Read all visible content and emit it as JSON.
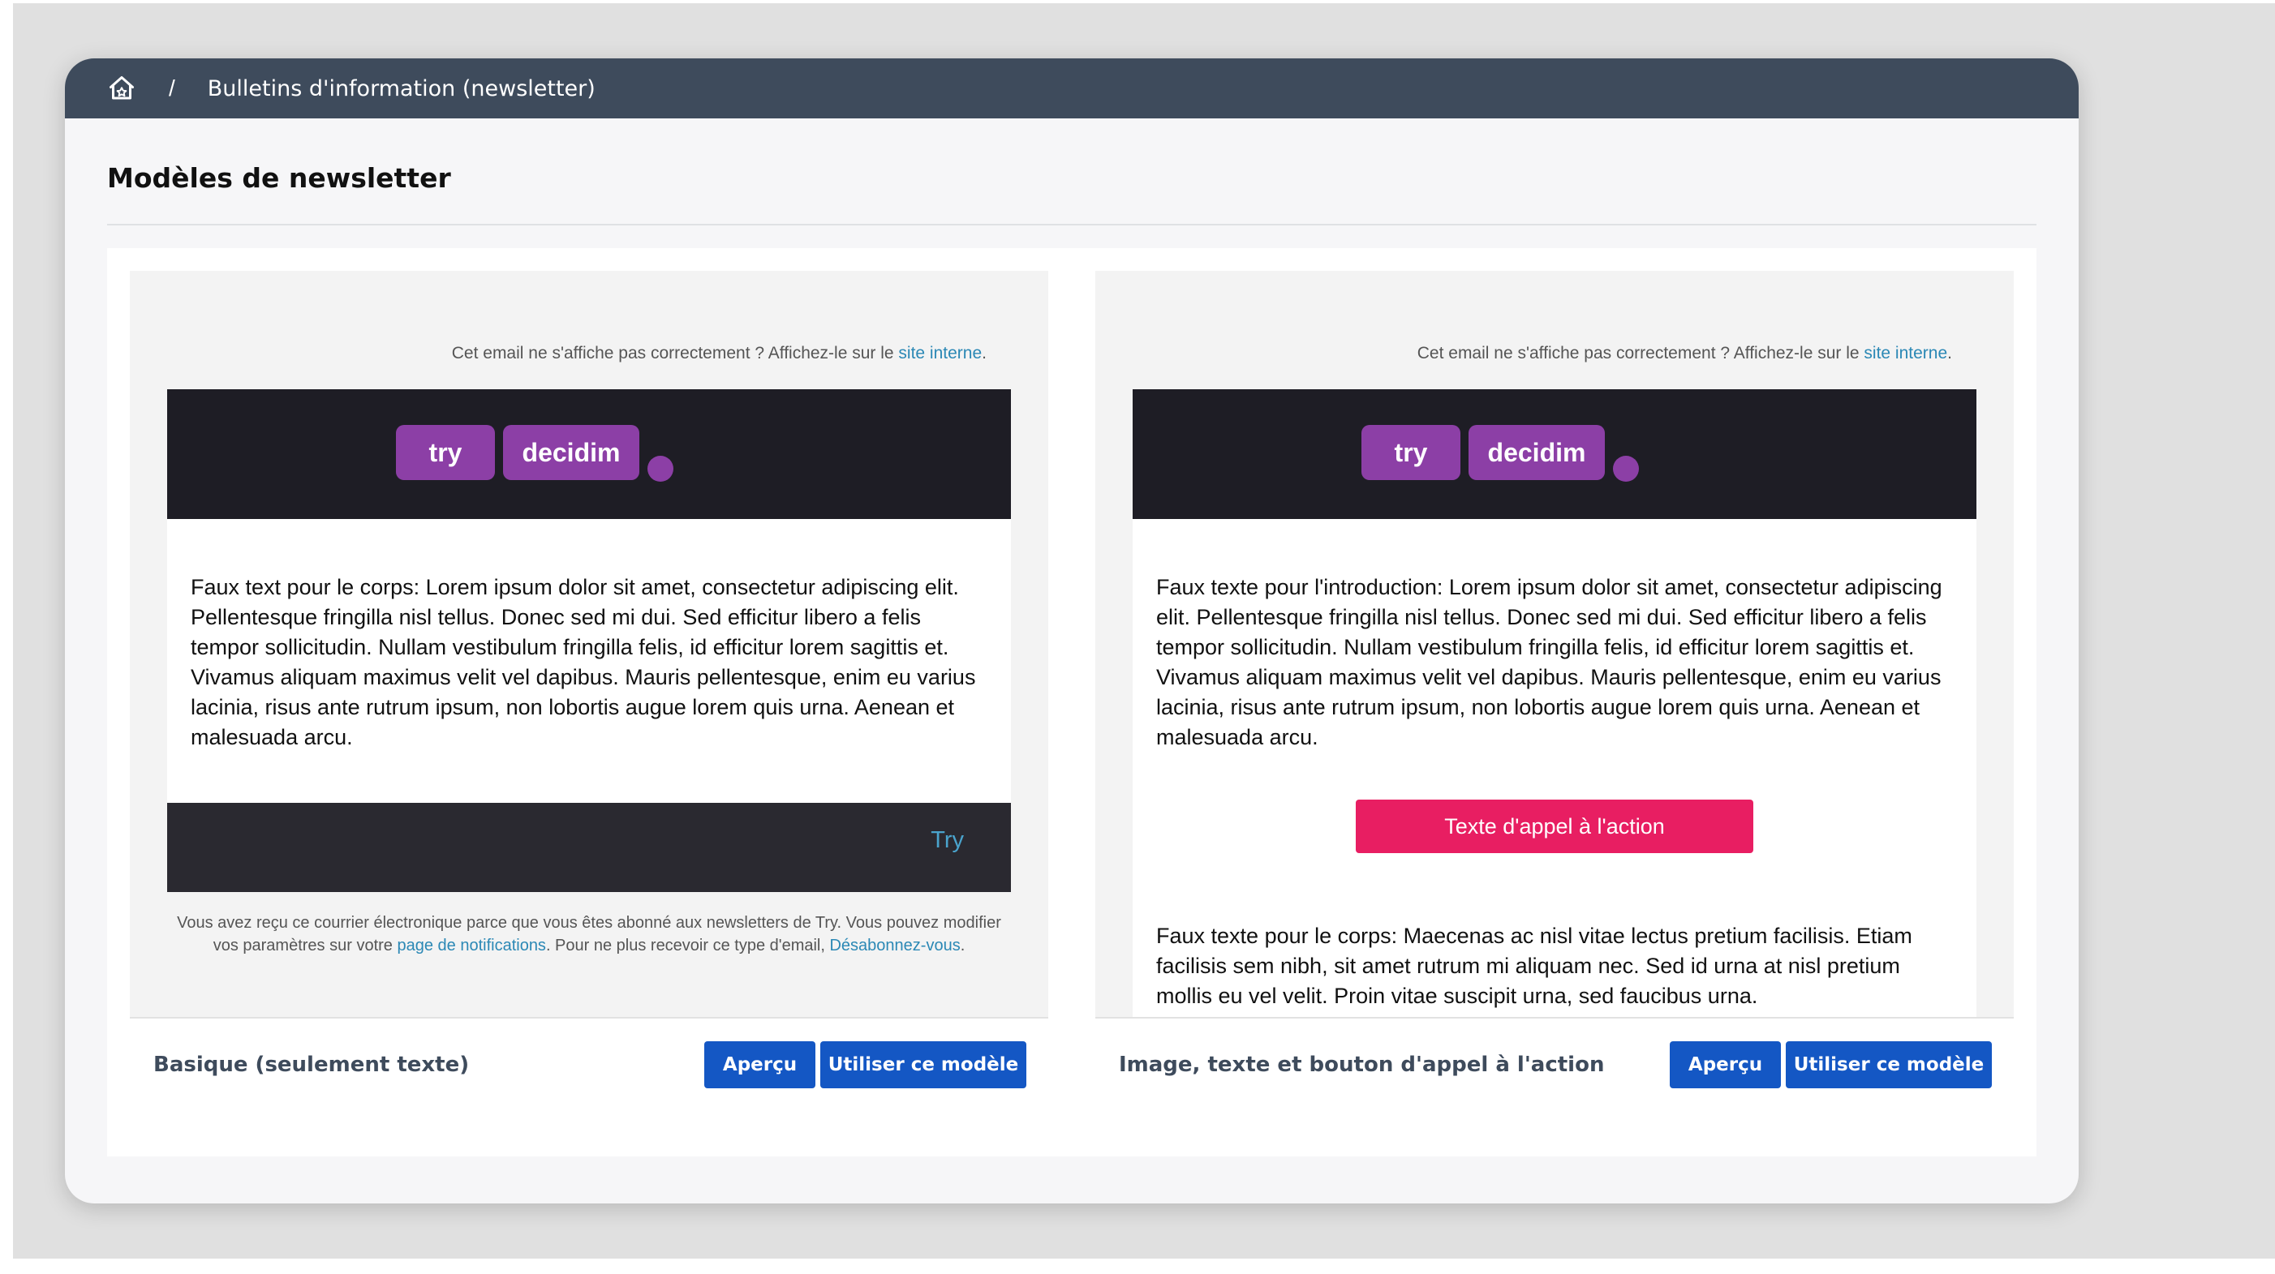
{
  "breadcrumb": {
    "separator": "/",
    "current": "Bulletins d'information (newsletter)"
  },
  "page": {
    "title": "Modèles de newsletter"
  },
  "email_common": {
    "top_note_prefix": "Cet email ne s'affiche pas correctement ? Affichez-le sur le ",
    "top_note_link": "site interne",
    "top_note_suffix": ".",
    "logo_part1": "try",
    "logo_part2": "decidim"
  },
  "templates": [
    {
      "name": "Basique (seulement texte)",
      "body": "Faux text pour le corps: Lorem ipsum dolor sit amet, consectetur adipiscing elit. Pellentesque fringilla nisl tellus. Donec sed mi dui. Sed efficitur libero a felis tempor sollicitudin. Nullam vestibulum fringilla felis, id efficitur lorem sagittis et. Vivamus aliquam maximus velit vel dapibus. Mauris pellentesque, enim eu varius lacinia, risus ante rutrum ipsum, non lobortis augue lorem quis urna. Aenean et malesuada arcu.",
      "footer_brand": "Try",
      "legal_part1": "Vous avez reçu ce courrier électronique parce que vous êtes abonné aux newsletters de Try. Vous pouvez modifier vos paramètres sur votre ",
      "legal_link1": "page de notifications",
      "legal_part2": ". Pour ne plus recevoir ce type d'email, ",
      "legal_link2": "Désabonnez-vous",
      "legal_part3": ".",
      "preview_label": "Aperçu",
      "use_label": "Utiliser ce modèle"
    },
    {
      "name": "Image, texte et bouton d'appel à l'action",
      "intro": "Faux texte pour l'introduction: Lorem ipsum dolor sit amet, consectetur adipiscing elit. Pellentesque fringilla nisl tellus. Donec sed mi dui. Sed efficitur libero a felis tempor sollicitudin. Nullam vestibulum fringilla felis, id efficitur lorem sagittis et. Vivamus aliquam maximus velit vel dapibus. Mauris pellentesque, enim eu varius lacinia, risus ante rutrum ipsum, non lobortis augue lorem quis urna. Aenean et malesuada arcu.",
      "cta_label": "Texte d'appel à l'action",
      "body": "Faux texte pour le corps: Maecenas ac nisl vitae lectus pretium facilisis. Etiam facilisis sem nibh, sit amet rutrum mi aliquam nec. Sed id urna at nisl pretium mollis eu vel velit. Proin vitae suscipit urna, sed faucibus urna.",
      "preview_label": "Aperçu",
      "use_label": "Utiliser ce modèle"
    }
  ],
  "colors": {
    "topbar": "#3e4b5c",
    "logo_purple": "#8c3fa6",
    "cta_pink": "#e81e62",
    "primary_button": "#1457c4",
    "link": "#2b88b5"
  }
}
